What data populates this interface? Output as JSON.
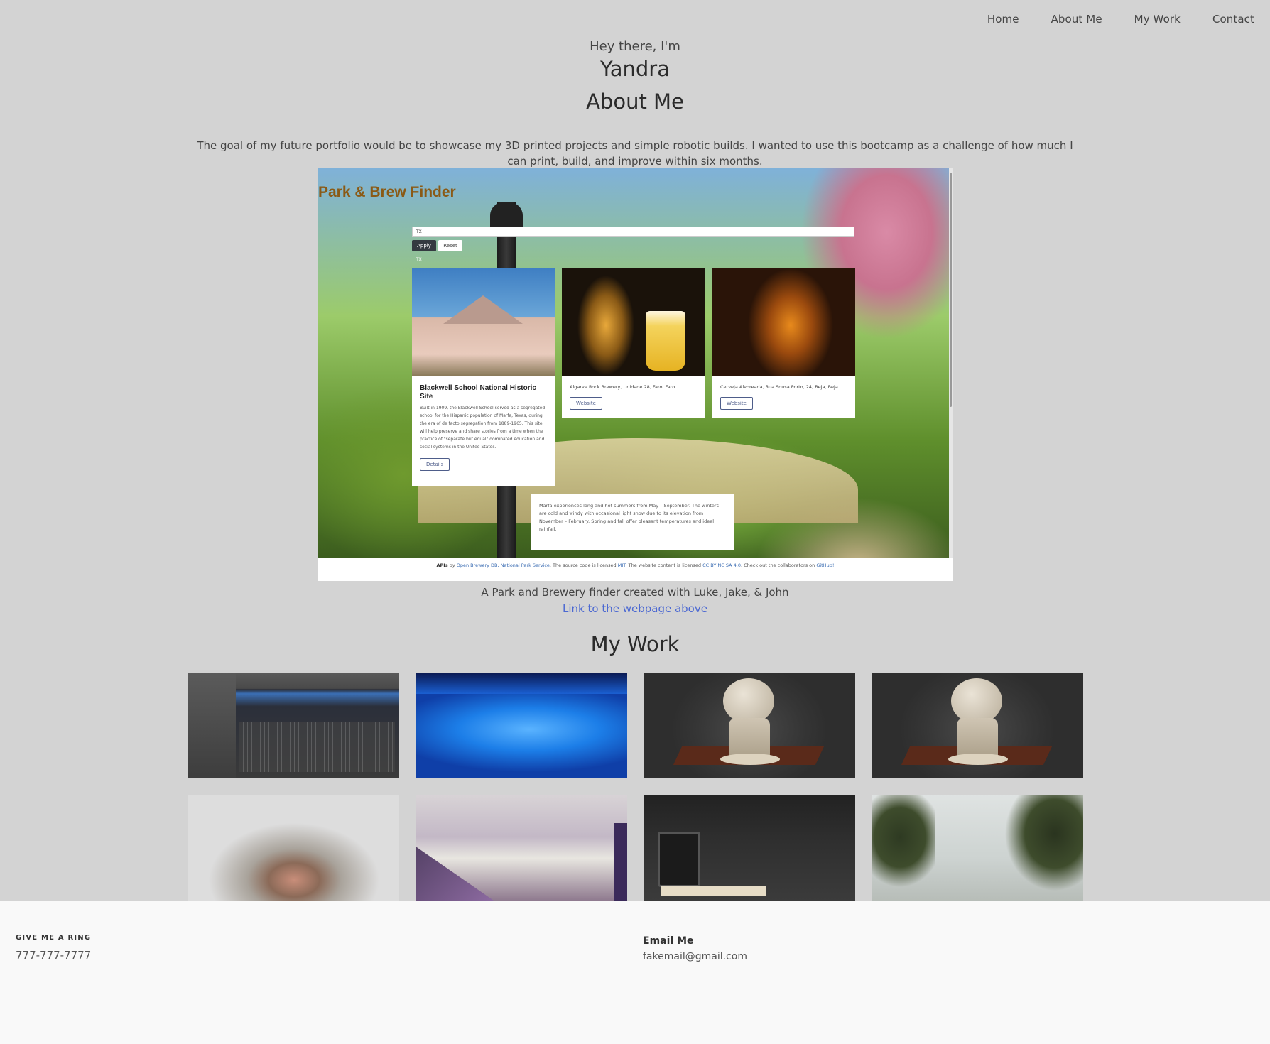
{
  "nav": {
    "items": [
      "Home",
      "About Me",
      "My Work",
      "Contact"
    ]
  },
  "hero": {
    "greeting": "Hey there, I'm",
    "name": "Yandra"
  },
  "about": {
    "heading": "About Me",
    "text": "The goal of my future portfolio would be to showcase my 3D printed projects and simple robotic builds. I wanted to use this bootcamp as a challenge of how much I can print, build, and improve within six months."
  },
  "featured": {
    "screenshot": {
      "title": "Park & Brew Finder",
      "filter_value": "TX",
      "apply_label": "Apply",
      "reset_label": "Reset",
      "small_tag": "TX",
      "cards": [
        {
          "title": "Blackwell School National Historic Site",
          "text": "Built in 1909, the Blackwell School served as a segregated school for the Hispanic population of Marfa, Texas, during the era of de facto segregation from 1889-1965. This site will help preserve and share stories from a time when the practice of \"separate but equal\" dominated education and social systems in the United States.",
          "button": "Details"
        },
        {
          "address": "Algarve Rock Brewery, Unidade 28, Faro, Faro.",
          "button": "Website"
        },
        {
          "address": "Cerveja Alvoreada, Rua Sousa Porto, 24, Beja, Beja.",
          "button": "Website"
        }
      ],
      "climate": "Marfa experiences long and hot summers from May – September. The winters are cold and windy with occasional light snow due to its elevation from November – February. Spring and fall offer pleasant temperatures and ideal rainfall.",
      "footer": {
        "apis_label": "APIs",
        "by": " by ",
        "api_links": "Open Brewery DB, National Park Service",
        "license_text": ". The source code is licensed ",
        "mit": "MIT",
        "content_text": ". The website content is licensed ",
        "cc": "CC BY NC SA 4.0",
        "collab_text": ". Check out the collaborators on ",
        "github": "GitHub!"
      }
    },
    "caption": "A Park and Brewery finder created with Luke, Jake, & John",
    "link_text": "Link to the webpage above"
  },
  "work": {
    "heading": "My Work",
    "tiles": [
      "audio-editor",
      "blue-3d-printer",
      "atlas-statue",
      "atlas-statue",
      "cat-nose",
      "sailing-boat-bird",
      "desk-gadgets",
      "foggy-trees"
    ]
  },
  "footer": {
    "ring_heading": "GIVE ME A RING",
    "phone": "777-777-7777",
    "email_heading": "Email Me",
    "email": "fakemail@gmail.com"
  },
  "colors": {
    "background": "#d3d3d3",
    "link": "#4b68d2",
    "footer_bg": "#f9f9f9"
  }
}
